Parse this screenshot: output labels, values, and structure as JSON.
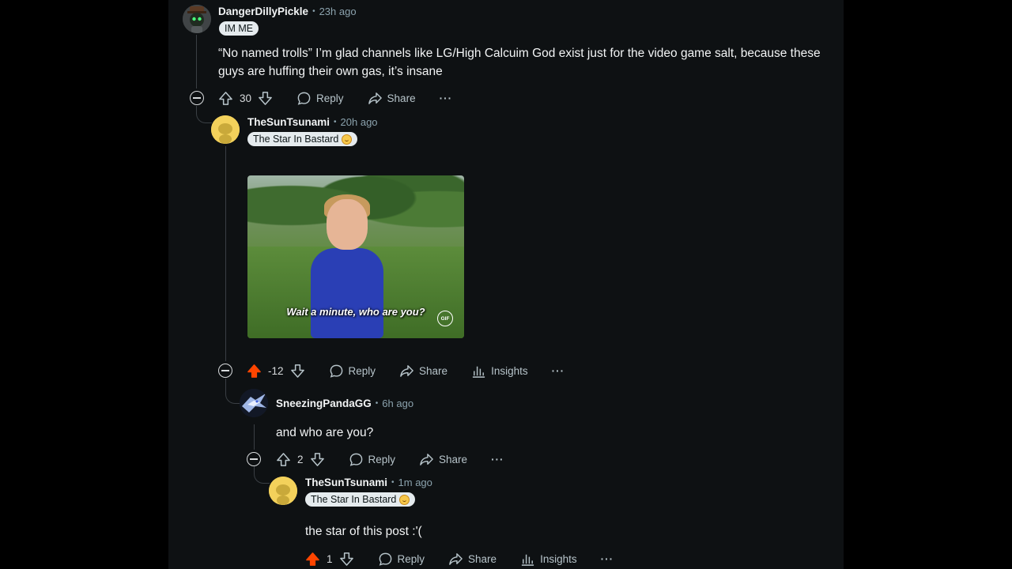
{
  "comments": [
    {
      "username": "DangerDillyPickle",
      "time": "23h ago",
      "flair": "IM ME",
      "body": "“No named trolls” I’m glad channels like LG/High Calcuim God exist just for the video game salt, because these guys are huffing their own gas, it’s insane",
      "votes": "30",
      "reply": "Reply",
      "share": "Share",
      "more": "···"
    },
    {
      "username": "TheSunTsunami",
      "time": "20h ago",
      "flair": "The Star In Bastard",
      "gif_caption": "Wait a minute, who are you?",
      "gif_badge": "GIF",
      "votes": "-12",
      "upvoted": true,
      "reply": "Reply",
      "share": "Share",
      "insights": "Insights",
      "more": "···"
    },
    {
      "username": "SneezingPandaGG",
      "time": "6h ago",
      "body": "and who are you?",
      "votes": "2",
      "reply": "Reply",
      "share": "Share",
      "more": "···"
    },
    {
      "username": "TheSunTsunami",
      "time": "1m ago",
      "flair": "The Star In Bastard",
      "body": "the star of this post :'(",
      "votes": "1",
      "upvoted": true,
      "reply": "Reply",
      "share": "Share",
      "insights": "Insights",
      "more": "···"
    }
  ],
  "colors": {
    "background": "#0e1113",
    "upvote_active": "#ff4500",
    "meta": "#8ba2ad",
    "text": "#f2f4f5"
  },
  "icons": [
    "upvote-icon",
    "downvote-icon",
    "reply-icon",
    "share-icon",
    "insights-icon",
    "collapse-icon",
    "more-icon"
  ]
}
